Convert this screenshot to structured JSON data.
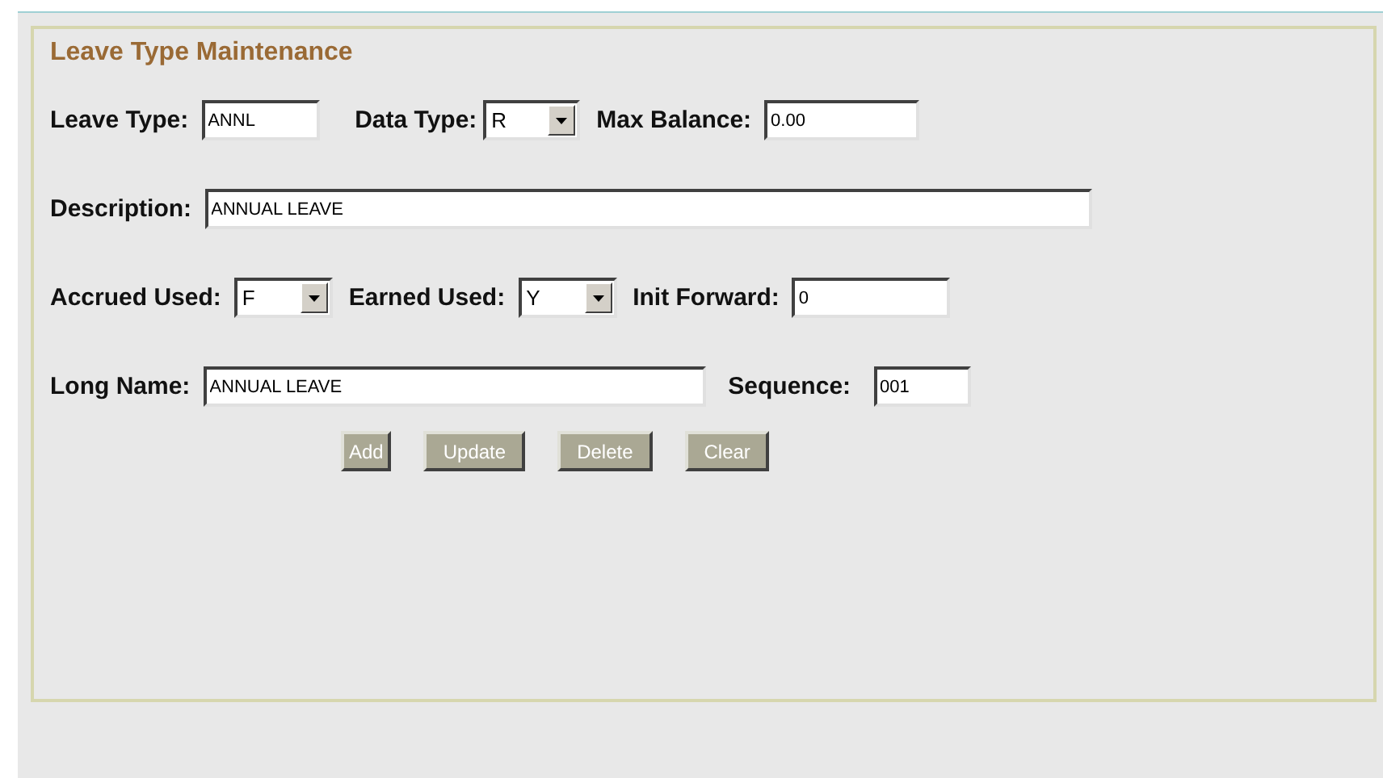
{
  "panel": {
    "title": "Leave Type Maintenance"
  },
  "rows": [
    {
      "fields": [
        {
          "kind": "text",
          "label": "Leave Type:",
          "value": "ANNL"
        },
        {
          "kind": "select",
          "label": "Data Type:",
          "value": "R"
        },
        {
          "kind": "text",
          "label": "Max Balance:",
          "value": "0.00"
        }
      ]
    },
    {
      "fields": [
        {
          "kind": "text",
          "label": "Description:",
          "value": "ANNUAL LEAVE"
        }
      ]
    },
    {
      "fields": [
        {
          "kind": "select",
          "label": "Accrued Used:",
          "value": "F"
        },
        {
          "kind": "select",
          "label": "Earned Used:",
          "value": "Y"
        },
        {
          "kind": "text",
          "label": "Init Forward:",
          "value": "0"
        }
      ]
    },
    {
      "fields": [
        {
          "kind": "text",
          "label": "Long Name:",
          "value": "ANNUAL LEAVE"
        },
        {
          "kind": "text",
          "label": "Sequence:",
          "value": "001"
        }
      ]
    }
  ],
  "buttons": [
    "Add",
    "Update",
    "Delete",
    "Clear"
  ]
}
